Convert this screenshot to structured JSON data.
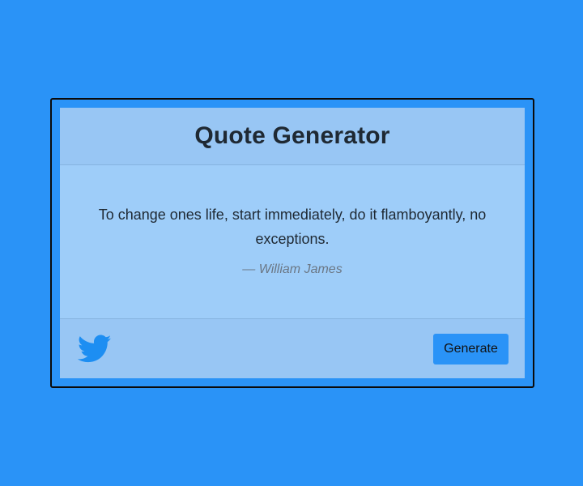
{
  "header": {
    "title": "Quote Generator"
  },
  "quote": {
    "text": "To change ones life, start immediately, do it flamboyantly, no exceptions.",
    "author": "— William James"
  },
  "footer": {
    "tweet_icon": "twitter-bird-icon",
    "generate_label": "Generate"
  },
  "colors": {
    "background": "#2a93f7",
    "card": "#9ecdf9",
    "header_footer": "#98c6f4",
    "button": "#2a93f7",
    "twitter": "#1da1f2"
  }
}
